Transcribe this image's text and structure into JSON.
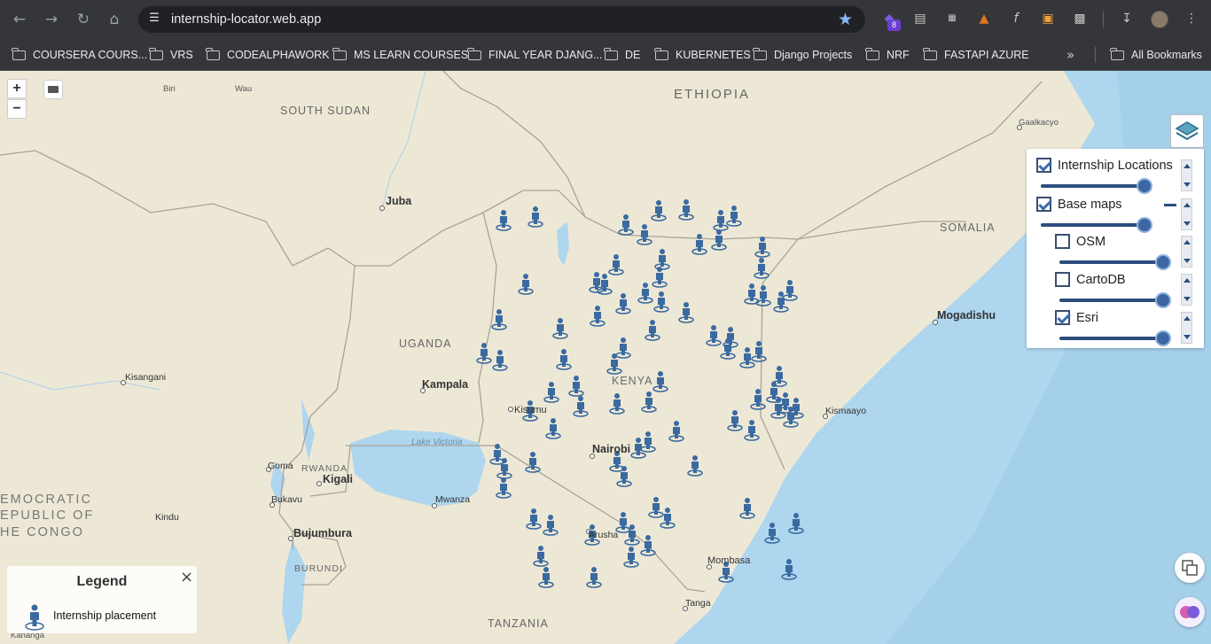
{
  "browser": {
    "url": "internship-locator.web.app",
    "extension_badge": "8",
    "icons": {
      "back": "arrow-left-icon",
      "forward": "arrow-right-icon",
      "reload": "reload-icon",
      "home": "home-icon",
      "site_info": "site-info-icon",
      "bookmark_star": "star-icon",
      "download": "download-icon",
      "menu": "kebab-menu-icon"
    },
    "accent_color": "#8ab4f8"
  },
  "bookmarks": {
    "items": [
      {
        "label": "COURSERA COURS..."
      },
      {
        "label": "VRS"
      },
      {
        "label": "CODEALPHAWORK"
      },
      {
        "label": "MS LEARN COURSES"
      },
      {
        "label": "FINAL YEAR DJANG..."
      },
      {
        "label": "DE"
      },
      {
        "label": "KUBERNETES"
      },
      {
        "label": "Django Projects"
      },
      {
        "label": "NRF"
      },
      {
        "label": "FASTAPI AZURE"
      }
    ],
    "more_label": "»",
    "all_bookmarks": "All Bookmarks"
  },
  "map": {
    "zoom_in": "+",
    "zoom_out": "−",
    "labels": {
      "ethiopia": "ETHIOPIA",
      "south_sudan": "SOUTH SUDAN",
      "somalia": "SOMALIA",
      "uganda": "UGANDA",
      "kenya": "KENYA",
      "rwanda": "RWANDA",
      "burundi": "BURUNDI",
      "tanzania": "TANZANIA",
      "drc_1": "EMOCRATIC",
      "drc_2": "EPUBLIC OF",
      "drc_3": "HE CONGO",
      "lake_victoria": "Lake Victoria",
      "juba": "Juba",
      "kampala": "Kampala",
      "kisumu": "Kisumu",
      "nairobi": "Nairobi",
      "mogadishu": "Mogadishu",
      "kismaayo": "Kismaayo",
      "mombasa": "Mombasa",
      "tanga": "Tanga",
      "kigali": "Kigali",
      "bujumbura": "Bujumbura",
      "goma": "Goma",
      "bukavu": "Bukavu",
      "mwanza": "Mwanza",
      "arusha": "Arusha",
      "kisangani": "Kisangani",
      "kindu": "Kindu",
      "gaalkacyo": "Gaalkacyo",
      "biri": "Biri",
      "wau": "Wau",
      "kananga": "Kananga"
    },
    "marker_color": "#3a6aa0",
    "land_color": "#ede8d6",
    "water_color": "#aed6ee"
  },
  "layers": {
    "toggle_icon": "layers-icon",
    "items": [
      {
        "label": "Internship Locations",
        "checked": true,
        "opacity": 1.0
      },
      {
        "label": "Base maps",
        "checked": true,
        "opacity": 1.0
      },
      {
        "label": "OSM",
        "checked": false,
        "opacity": 1.0
      },
      {
        "label": "CartoDB",
        "checked": false,
        "opacity": 1.0
      },
      {
        "label": "Esri",
        "checked": true,
        "opacity": 1.0
      }
    ]
  },
  "legend": {
    "title": "Legend",
    "close": "×",
    "entry_label": "Internship placement",
    "entry_icon": "person-marker-icon"
  },
  "floating": {
    "translate_icon": "translate-icon",
    "assistant_icon": "brain-icon"
  }
}
